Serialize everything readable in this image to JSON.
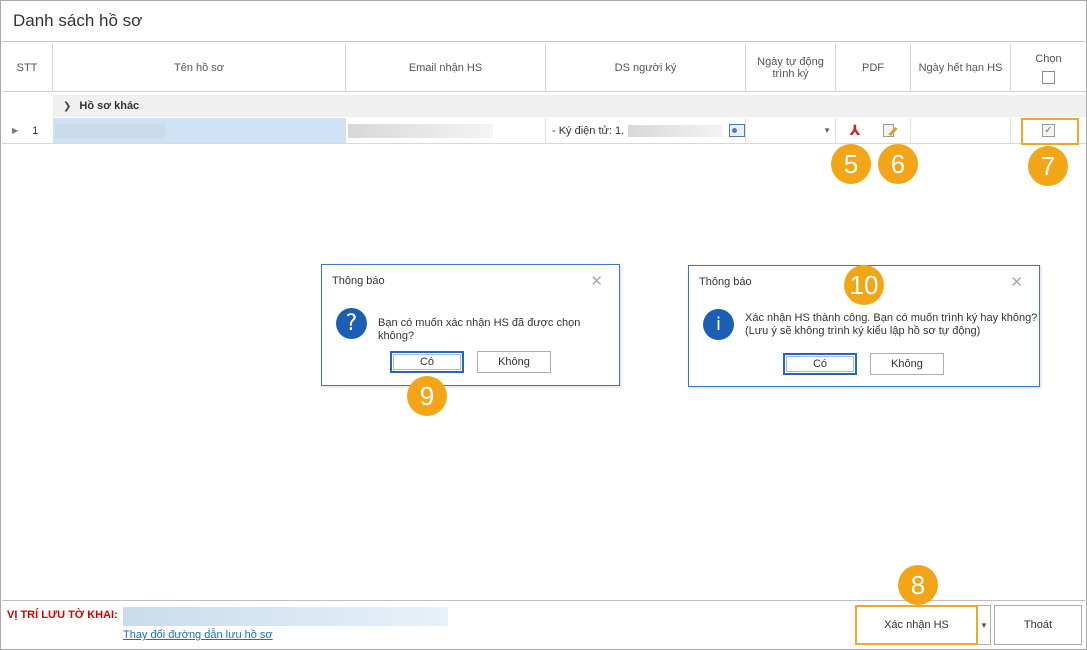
{
  "page": {
    "title": "Danh sách hồ sơ"
  },
  "grid": {
    "columns": [
      {
        "key": "stt",
        "label": "STT"
      },
      {
        "key": "ten",
        "label": "Tên hồ sơ"
      },
      {
        "key": "email",
        "label": "Email nhận HS"
      },
      {
        "key": "ds",
        "label": "DS người ký"
      },
      {
        "key": "ngay_tu_dong",
        "label": "Ngày tự động trình ký"
      },
      {
        "key": "pdf",
        "label": "PDF"
      },
      {
        "key": "ngay_het_han",
        "label": "Ngày hết hạn HS"
      },
      {
        "key": "chon",
        "label": "Chọn"
      }
    ],
    "group_label": "Hồ sơ khác",
    "rows": [
      {
        "stt": "1",
        "signer": "- Ký điện tử: 1.",
        "selected": true
      }
    ]
  },
  "annotations": {
    "b5": "5",
    "b6": "6",
    "b7": "7",
    "b8": "8",
    "b9": "9",
    "b10": "10",
    "color": "#f2a516"
  },
  "dialog_confirm": {
    "title": "Thông báo",
    "close": "✕",
    "icon": "question-icon",
    "message": "Bạn có muốn xác nhận HS đã được chọn không?",
    "yes": "Có",
    "no": "Không"
  },
  "dialog_success": {
    "title": "Thông báo",
    "close": "✕",
    "icon": "info-icon",
    "message_1": "Xác nhận HS thành công. Bạn có muốn trình ký hay không?",
    "message_2": "(Lưu ý sẽ không trình ký kiểu lập hồ sơ tự động)",
    "yes": "Có",
    "no": "Không"
  },
  "footer": {
    "location_label": "VỊ TRÍ LƯU TỜ KHAI:",
    "change_link": "Thay đổi đường dẫn lưu hồ sơ",
    "confirm_button": "Xác nhận HS",
    "exit_button": "Thoát"
  }
}
